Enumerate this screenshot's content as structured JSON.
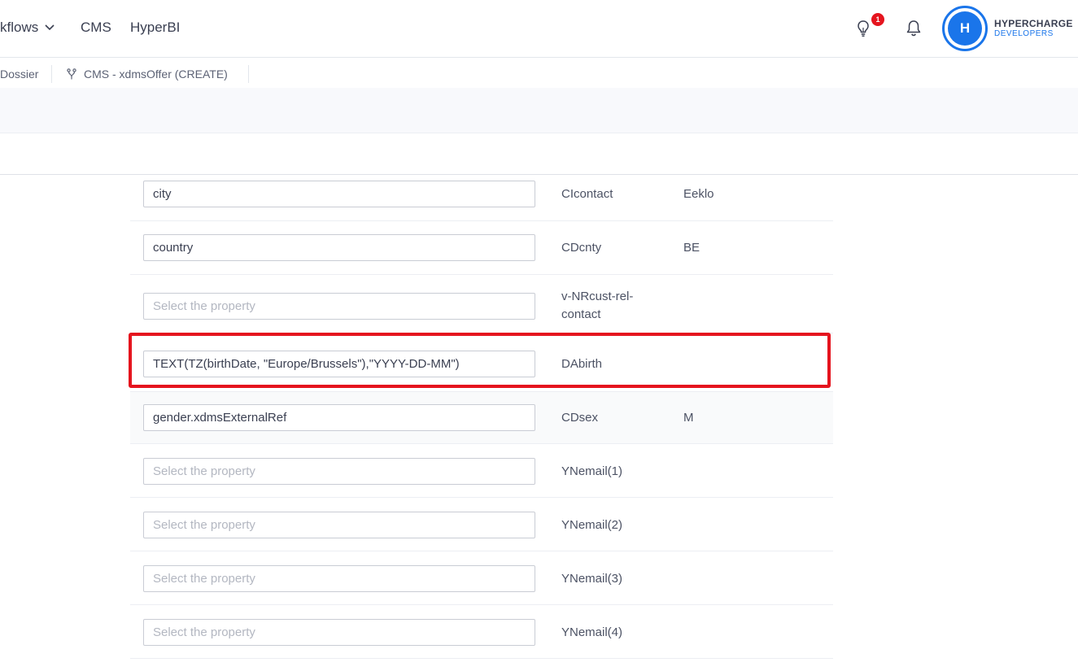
{
  "topnav": {
    "workflows_label": "kflows",
    "cms_label": "CMS",
    "hyperbi_label": "HyperBI",
    "notification_count": "1",
    "avatar_initial": "H",
    "brand_title": "HYPERCHARGE",
    "brand_subtitle": "DEVELOPERS"
  },
  "tabs": [
    {
      "label": "Dossier"
    },
    {
      "label": "CMS - xdmsOffer (CREATE)"
    }
  ],
  "placeholder": "Select the property",
  "rows": [
    {
      "value": "city",
      "field": "CIcontact",
      "sample": "Eeklo"
    },
    {
      "value": "country",
      "field": "CDcnty",
      "sample": "BE"
    },
    {
      "value": "",
      "field": "v-NRcust-rel-contact",
      "sample": ""
    },
    {
      "value": "TEXT(TZ(birthDate, \"Europe/Brussels\"),\"YYYY-DD-MM\")",
      "field": "DAbirth",
      "sample": ""
    },
    {
      "value": "gender.xdmsExternalRef",
      "field": "CDsex",
      "sample": "M"
    },
    {
      "value": "",
      "field": "YNemail(1)",
      "sample": ""
    },
    {
      "value": "",
      "field": "YNemail(2)",
      "sample": ""
    },
    {
      "value": "",
      "field": "YNemail(3)",
      "sample": ""
    },
    {
      "value": "",
      "field": "YNemail(4)",
      "sample": ""
    }
  ],
  "colors": {
    "accent": "#1a75ea",
    "badge": "#e5141e",
    "highlight": "#e5141e"
  }
}
